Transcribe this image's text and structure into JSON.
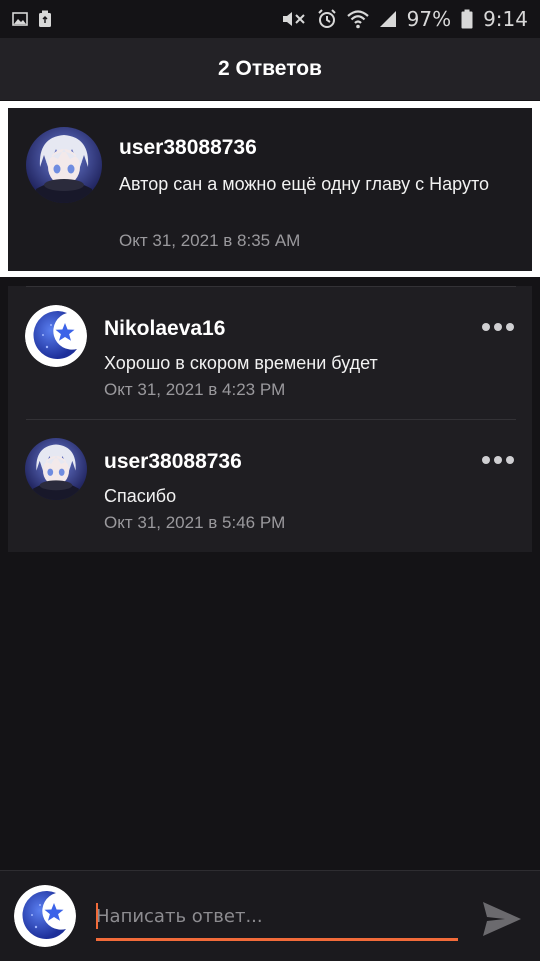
{
  "status_bar": {
    "battery": "97%",
    "time": "9:14",
    "left_icons": [
      "image-icon",
      "recycle-icon"
    ],
    "right_icons": [
      "mute-icon",
      "alarm-icon",
      "wifi-icon",
      "signal-icon",
      "battery-icon"
    ]
  },
  "header": {
    "title": "2 Ответов"
  },
  "original_comment": {
    "username": "user38088736",
    "text": "Автор сан а можно ещё одну главу с Наруто",
    "timestamp": "Окт 31, 2021 в 8:35 AM",
    "avatar": "anime-avatar"
  },
  "replies": [
    {
      "username": "Nikolaeva16",
      "text": "Хорошо в скором времени будет",
      "timestamp": "Окт 31, 2021 в 4:23 PM",
      "avatar": "moon-star-avatar"
    },
    {
      "username": "user38088736",
      "text": "Спасибо",
      "timestamp": "Окт 31, 2021 в 5:46 PM",
      "avatar": "anime-avatar"
    }
  ],
  "composer": {
    "placeholder": "Написать ответ...",
    "value": "",
    "send_icon": "send-icon",
    "avatar": "moon-star-avatar"
  },
  "colors": {
    "background": "#141316",
    "header": "#232226",
    "card": "#1f1e22",
    "accent": "#f26b3a",
    "muted_text": "#9a999d"
  }
}
